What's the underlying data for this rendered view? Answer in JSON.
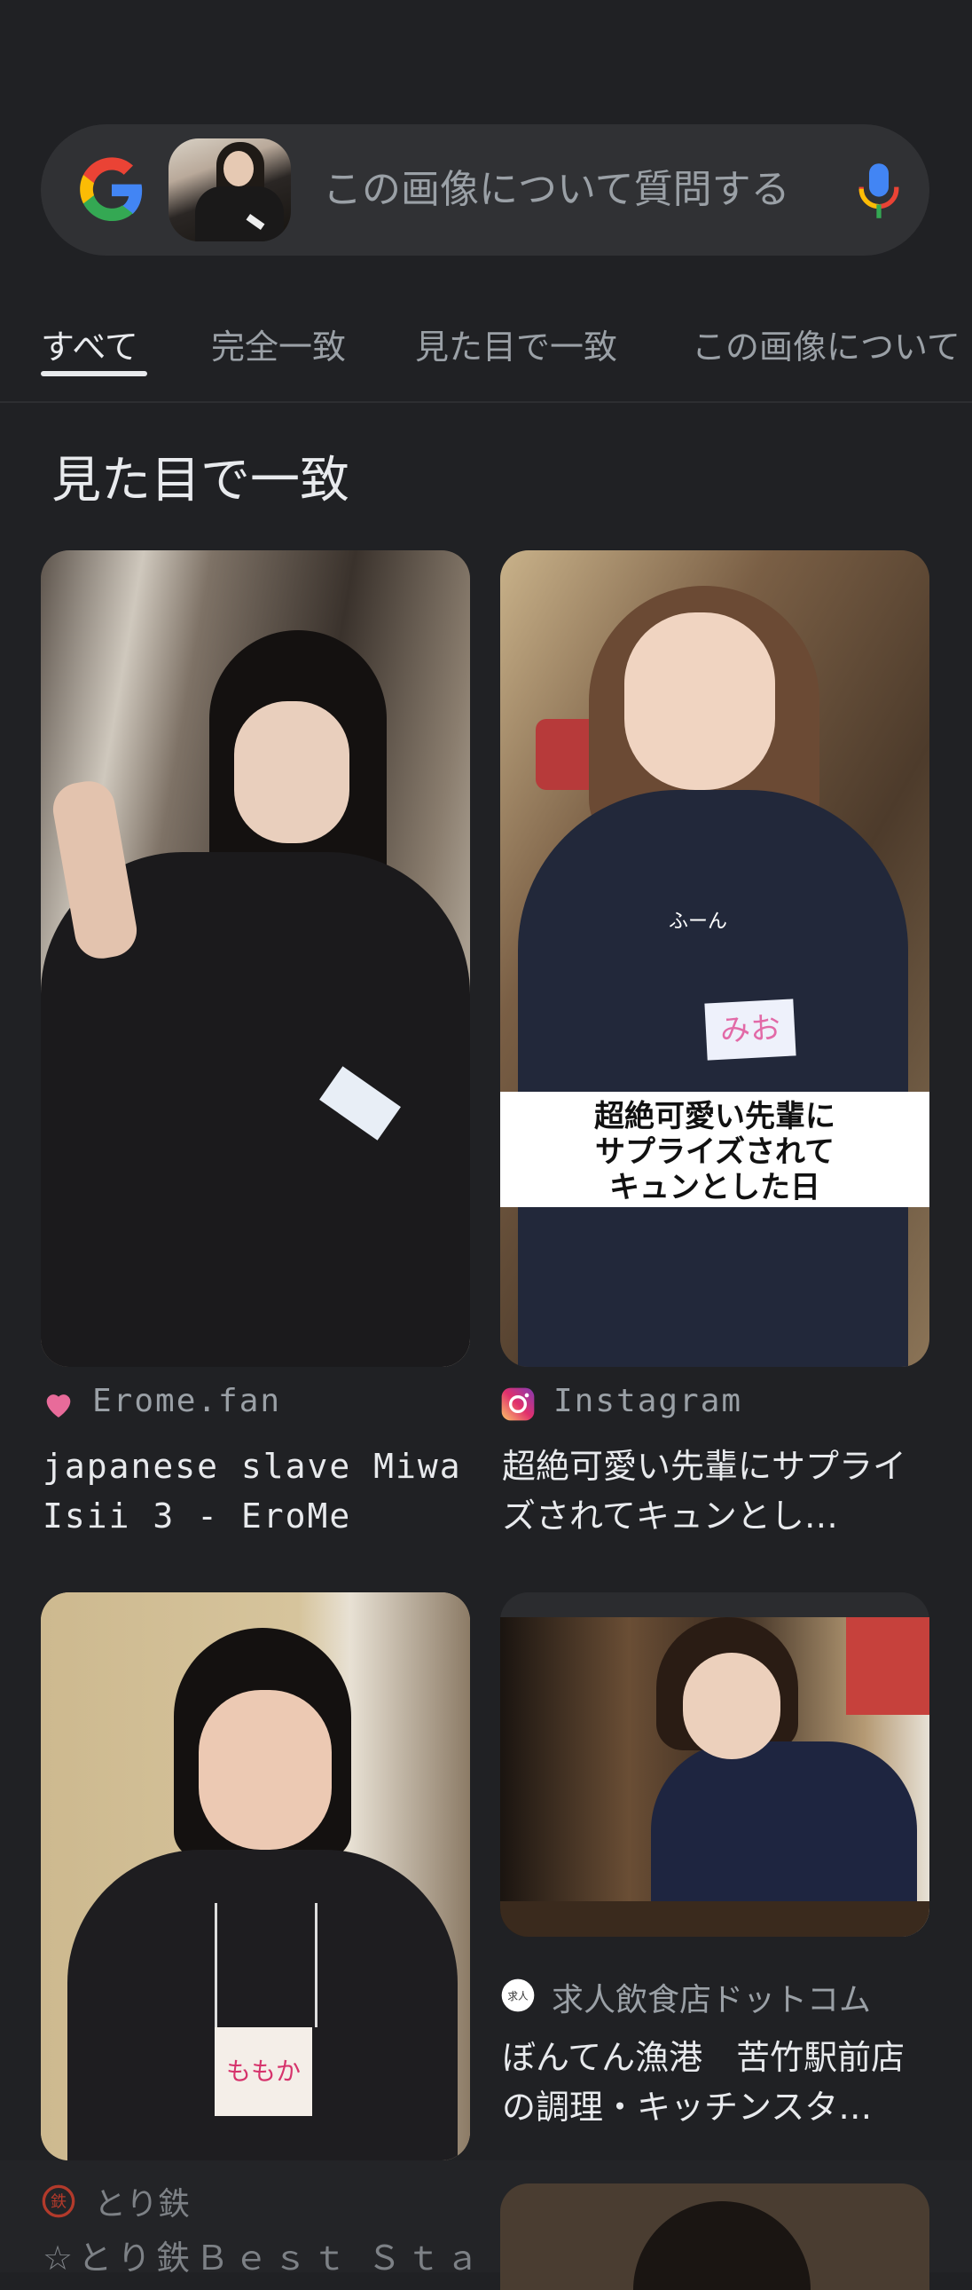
{
  "search": {
    "placeholder": "この画像について質問する",
    "logo_icon": "google-g-icon",
    "mic_icon": "mic-icon"
  },
  "tabs": [
    {
      "label": "すべて",
      "active": true
    },
    {
      "label": "完全一致",
      "active": false
    },
    {
      "label": "見た目で一致",
      "active": false
    },
    {
      "label": "この画像について",
      "active": false
    }
  ],
  "section": {
    "title": "見た目で一致"
  },
  "results": [
    {
      "source": "Erome.fan",
      "source_icon": "heart-icon",
      "title": "japanese slave Miwa Isii 3 - EroMe"
    },
    {
      "source": "Instagram",
      "source_icon": "instagram-icon",
      "title": "超絶可愛い先輩にサプライズされてキュンとし…",
      "image_caption_lines": [
        "超絶可愛い先輩に",
        "サプライズされて",
        "キュンとした日"
      ],
      "image_nametag": "みお",
      "image_logo": "ふーん"
    },
    {
      "source": "とり鉄",
      "source_icon": "toritetsu-icon",
      "title": "☆とり鉄Ｂｅｓｔ Ｓｔａ",
      "image_nametag": "ももか"
    },
    {
      "source": "求人飲食店ドットコム",
      "source_icon": "kyujin-icon",
      "title": "ぼんてん漁港　苦竹駅前店の調理・キッチンスタ…"
    }
  ],
  "colors": {
    "background": "#202124",
    "searchbar": "#303134",
    "text_primary": "#e8eaed",
    "text_secondary": "#9aa0a6"
  }
}
